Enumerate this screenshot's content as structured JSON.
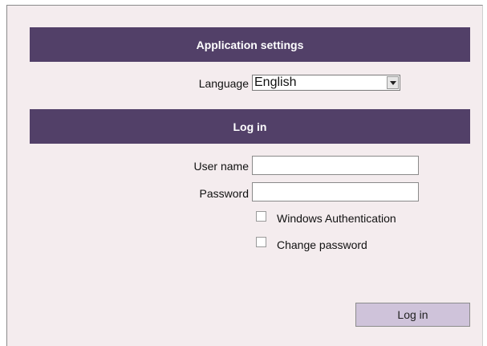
{
  "settings": {
    "header": "Application settings",
    "language_label": "Language",
    "language_value": "English"
  },
  "login": {
    "header": "Log in",
    "username_label": "User name",
    "username_value": "",
    "password_label": "Password",
    "password_value": "",
    "windows_auth_label": "Windows Authentication",
    "windows_auth_checked": false,
    "change_password_label": "Change password",
    "change_password_checked": false,
    "button_label": "Log in"
  },
  "colors": {
    "header_bg": "#524068",
    "panel_bg": "#f4ecee",
    "button_bg": "#cfc3da"
  }
}
